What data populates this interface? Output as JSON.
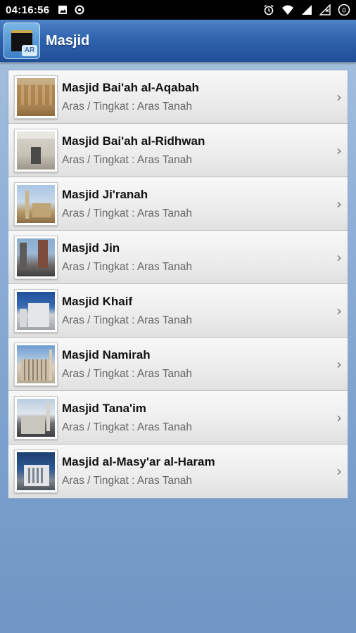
{
  "status_bar": {
    "time": "04:16:56",
    "left_icons": [
      "image-icon",
      "target-icon"
    ],
    "right_icons": [
      "alarm-icon",
      "wifi-icon",
      "signal-icon",
      "signal-icon",
      "battery-icon"
    ]
  },
  "app_bar": {
    "title": "Masjid",
    "icon_badge": "AR"
  },
  "list": {
    "items": [
      {
        "title": "Masjid Bai'ah al-Aqabah",
        "subtitle": "Aras / Tingkat : Aras Tanah"
      },
      {
        "title": "Masjid Bai'ah al-Ridhwan",
        "subtitle": "Aras / Tingkat : Aras Tanah"
      },
      {
        "title": "Masjid Ji'ranah",
        "subtitle": "Aras / Tingkat : Aras Tanah"
      },
      {
        "title": "Masjid Jin",
        "subtitle": "Aras / Tingkat : Aras Tanah"
      },
      {
        "title": "Masjid Khaif",
        "subtitle": "Aras / Tingkat : Aras Tanah"
      },
      {
        "title": "Masjid Namirah",
        "subtitle": "Aras / Tingkat : Aras Tanah"
      },
      {
        "title": "Masjid Tana'im",
        "subtitle": "Aras / Tingkat : Aras Tanah"
      },
      {
        "title": "Masjid al-Masy'ar al-Haram",
        "subtitle": "Aras / Tingkat : Aras Tanah"
      }
    ]
  },
  "colors": {
    "app_bar": "#2f63ad",
    "background": "#8fb0d6",
    "row_bg": "#ececec",
    "title_text": "#111111",
    "subtitle_text": "#666666"
  }
}
